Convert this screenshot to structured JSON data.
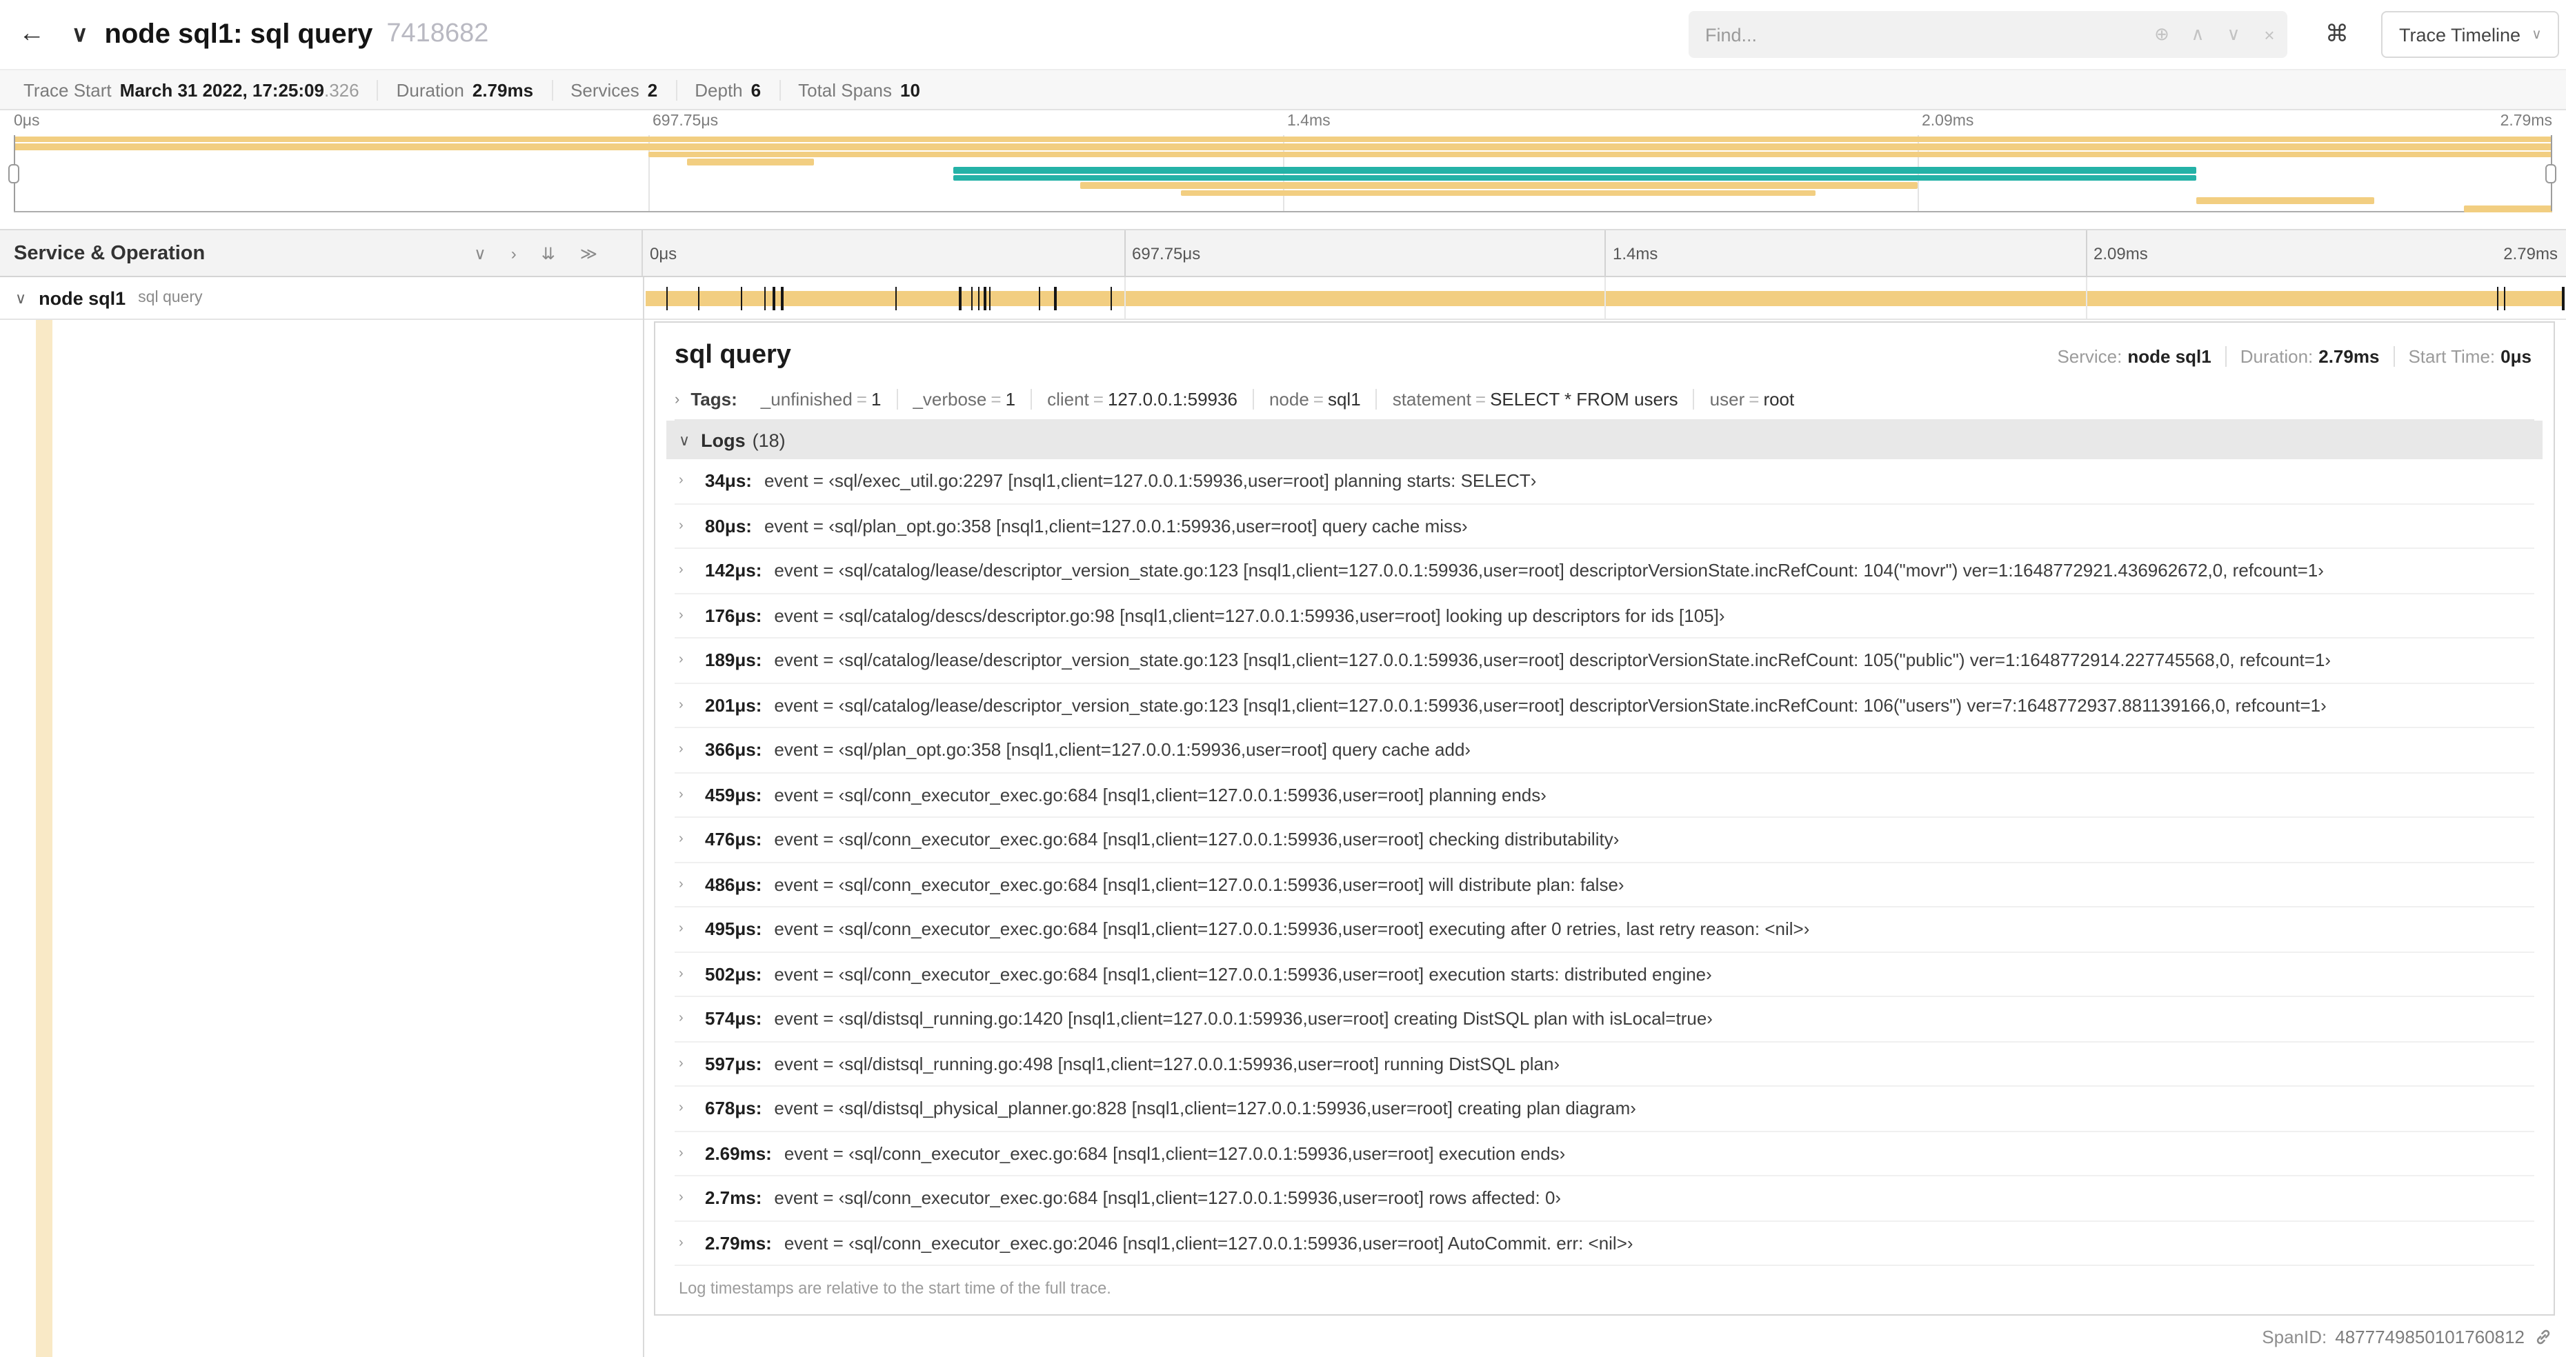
{
  "colors": {
    "tan": "#F2CE81",
    "teal": "#24B2A7",
    "indent": "rgba(242,206,129,0.45)"
  },
  "header": {
    "back_icon": "←",
    "collapse_icon": "∨",
    "title": "node sql1: sql query",
    "trace_id": "7418682",
    "find": {
      "placeholder": "Find...",
      "icons": [
        {
          "name": "locate-match-icon",
          "glyph": "⊕"
        },
        {
          "name": "prev-match-icon",
          "glyph": "∧"
        },
        {
          "name": "next-match-icon",
          "glyph": "∨"
        },
        {
          "name": "clear-find-icon",
          "glyph": "×"
        }
      ]
    },
    "shortcuts_icon": "⌘",
    "view_dropdown": {
      "label": "Trace Timeline",
      "caret": "∨"
    }
  },
  "summary": {
    "items": [
      {
        "label": "Trace Start",
        "value": "March 31 2022, 17:25:09",
        "suffix": ".326"
      },
      {
        "label": "Duration",
        "value": "2.79ms"
      },
      {
        "label": "Services",
        "value": "2"
      },
      {
        "label": "Depth",
        "value": "6"
      },
      {
        "label": "Total Spans",
        "value": "10"
      }
    ]
  },
  "timeline": {
    "tick_labels": [
      "0μs",
      "697.75μs",
      "1.4ms",
      "2.09ms",
      "2.79ms"
    ],
    "header_title": "Service & Operation",
    "collapser_icons": [
      {
        "name": "collapse-one-icon",
        "glyph": "∨"
      },
      {
        "name": "expand-one-icon",
        "glyph": "›"
      },
      {
        "name": "collapse-all-icon",
        "glyph": "⇊"
      },
      {
        "name": "expand-all-icon",
        "glyph": "≫"
      }
    ]
  },
  "minimap": {
    "spans": [
      {
        "row": 0,
        "start": 0,
        "width": 100,
        "color": "tan"
      },
      {
        "row": 1,
        "start": 0,
        "width": 100,
        "color": "tan"
      },
      {
        "row": 2,
        "start": 25,
        "width": 75,
        "color": "tan"
      },
      {
        "row": 3,
        "start": 26.5,
        "width": 5,
        "color": "tan"
      },
      {
        "row": 4,
        "start": 37,
        "width": 49,
        "color": "teal"
      },
      {
        "row": 5,
        "start": 37,
        "width": 49,
        "color": "teal"
      },
      {
        "row": 6,
        "start": 42,
        "width": 33,
        "color": "tan"
      },
      {
        "row": 7,
        "start": 46,
        "width": 25,
        "color": "tan"
      },
      {
        "row": 8,
        "start": 86,
        "width": 7,
        "color": "tan"
      },
      {
        "row": 9,
        "start": 96.5,
        "width": 3.5,
        "color": "tan"
      }
    ]
  },
  "span_row": {
    "chevron": "∨",
    "service": "node sql1",
    "operation": "sql query"
  },
  "trace_duration_us": 2790,
  "detail": {
    "title": "sql query",
    "meta": [
      {
        "label": "Service:",
        "value": "node sql1"
      },
      {
        "label": "Duration:",
        "value": "2.79ms"
      },
      {
        "label": "Start Time:",
        "value": "0μs"
      }
    ],
    "tags_chevron": "›",
    "tags_label": "Tags:",
    "tags": [
      {
        "key": "_unfinished",
        "value": "1"
      },
      {
        "key": "_verbose",
        "value": "1"
      },
      {
        "key": "client",
        "value": "127.0.0.1:59936"
      },
      {
        "key": "node",
        "value": "sql1"
      },
      {
        "key": "statement",
        "value": "SELECT * FROM users"
      },
      {
        "key": "user",
        "value": "root"
      }
    ],
    "logs_chevron": "∨",
    "logs_label": "Logs",
    "logs_count": "(18)",
    "log_row_chevron": "›",
    "logs": [
      {
        "time": "34μs:",
        "t_us": 34,
        "text": "event = ‹sql/exec_util.go:2297 [nsql1,client=127.0.0.1:59936,user=root] planning starts: SELECT›"
      },
      {
        "time": "80μs:",
        "t_us": 80,
        "text": "event = ‹sql/plan_opt.go:358 [nsql1,client=127.0.0.1:59936,user=root] query cache miss›"
      },
      {
        "time": "142μs:",
        "t_us": 142,
        "text": "event = ‹sql/catalog/lease/descriptor_version_state.go:123 [nsql1,client=127.0.0.1:59936,user=root] descriptorVersionState.incRefCount: 104(\"movr\") ver=1:1648772921.436962672,0, refcount=1›"
      },
      {
        "time": "176μs:",
        "t_us": 176,
        "text": "event = ‹sql/catalog/descs/descriptor.go:98 [nsql1,client=127.0.0.1:59936,user=root] looking up descriptors for ids [105]›"
      },
      {
        "time": "189μs:",
        "t_us": 189,
        "text": "event = ‹sql/catalog/lease/descriptor_version_state.go:123 [nsql1,client=127.0.0.1:59936,user=root] descriptorVersionState.incRefCount: 105(\"public\") ver=1:1648772914.227745568,0, refcount=1›"
      },
      {
        "time": "201μs:",
        "t_us": 201,
        "text": "event = ‹sql/catalog/lease/descriptor_version_state.go:123 [nsql1,client=127.0.0.1:59936,user=root] descriptorVersionState.incRefCount: 106(\"users\") ver=7:1648772937.881139166,0, refcount=1›"
      },
      {
        "time": "366μs:",
        "t_us": 366,
        "text": "event = ‹sql/plan_opt.go:358 [nsql1,client=127.0.0.1:59936,user=root] query cache add›"
      },
      {
        "time": "459μs:",
        "t_us": 459,
        "text": "event = ‹sql/conn_executor_exec.go:684 [nsql1,client=127.0.0.1:59936,user=root] planning ends›"
      },
      {
        "time": "476μs:",
        "t_us": 476,
        "text": "event = ‹sql/conn_executor_exec.go:684 [nsql1,client=127.0.0.1:59936,user=root] checking distributability›"
      },
      {
        "time": "486μs:",
        "t_us": 486,
        "text": "event = ‹sql/conn_executor_exec.go:684 [nsql1,client=127.0.0.1:59936,user=root] will distribute plan: false›"
      },
      {
        "time": "495μs:",
        "t_us": 495,
        "text": "event = ‹sql/conn_executor_exec.go:684 [nsql1,client=127.0.0.1:59936,user=root] executing after 0 retries, last retry reason: <nil>›"
      },
      {
        "time": "502μs:",
        "t_us": 502,
        "text": "event = ‹sql/conn_executor_exec.go:684 [nsql1,client=127.0.0.1:59936,user=root] execution starts: distributed engine›"
      },
      {
        "time": "574μs:",
        "t_us": 574,
        "text": "event = ‹sql/distsql_running.go:1420 [nsql1,client=127.0.0.1:59936,user=root] creating DistSQL plan with isLocal=true›"
      },
      {
        "time": "597μs:",
        "t_us": 597,
        "text": "event = ‹sql/distsql_running.go:498 [nsql1,client=127.0.0.1:59936,user=root] running DistSQL plan›"
      },
      {
        "time": "678μs:",
        "t_us": 678,
        "text": "event = ‹sql/distsql_physical_planner.go:828 [nsql1,client=127.0.0.1:59936,user=root] creating plan diagram›"
      },
      {
        "time": "2.69ms:",
        "t_us": 2690,
        "text": "event = ‹sql/conn_executor_exec.go:684 [nsql1,client=127.0.0.1:59936,user=root] execution ends›"
      },
      {
        "time": "2.7ms:",
        "t_us": 2700,
        "text": "event = ‹sql/conn_executor_exec.go:684 [nsql1,client=127.0.0.1:59936,user=root] rows affected: 0›"
      },
      {
        "time": "2.79ms:",
        "t_us": 2790,
        "text": "event = ‹sql/conn_executor_exec.go:2046 [nsql1,client=127.0.0.1:59936,user=root] AutoCommit. err: <nil>›"
      }
    ],
    "footer_note": "Log timestamps are relative to the start time of the full trace.",
    "span_id_label": "SpanID:",
    "span_id": "4877749850101760812"
  }
}
